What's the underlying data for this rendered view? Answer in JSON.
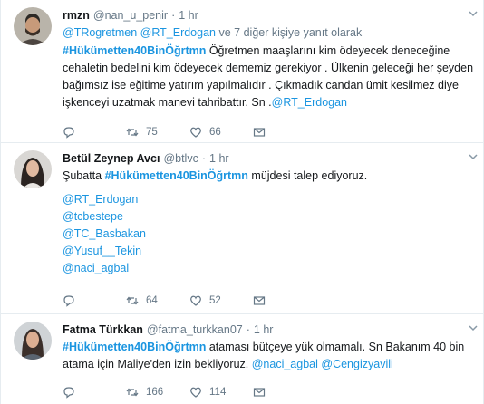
{
  "tweets": [
    {
      "name": "rmzn",
      "handle": "@nan_u_penir",
      "dot": "·",
      "time": "1 hr",
      "replying": {
        "mention1": "@TRogretmen",
        "mention2": "@RT_Erdogan",
        "suffix": "ve 7 diğer kişiye yanıt olarak"
      },
      "line1_hashtag": "#Hükümetten40BinÖğrtmn",
      "line1_text": " Öğretmen maaşlarını kim ödeyecek deneceğine",
      "line2": "cehaletin bedelini kim ödeyecek dememiz gerekiyor . Ülkenin geleceği her şeyden",
      "line3": "bağımsız ise eğitime yatırım yapılmalıdır . Çıkmadık candan ümit kesilmez diye",
      "line4_text": "işkenceyi uzatmak manevi tahribattır. Sn .",
      "line4_mention": "@RT_Erdogan",
      "retweets": "75",
      "likes": "66"
    },
    {
      "name": "Betül Zeynep Avcı",
      "handle": "@btlvc",
      "dot": "·",
      "time": "1 hr",
      "line1_pre": "Şubatta ",
      "line1_hashtag": "#Hükümetten40BinÖğrtmn",
      "line1_post": " müjdesi talep ediyoruz.",
      "mentions": [
        "@RT_Erdogan",
        "@tcbestepe",
        "@TC_Basbakan",
        "@Yusuf__Tekin",
        "@naci_agbal"
      ],
      "retweets": "64",
      "likes": "52"
    },
    {
      "name": "Fatma Türkkan",
      "handle": "@fatma_turkkan07",
      "dot": "·",
      "time": "1 hr",
      "line1_hashtag": "#Hükümetten40BinÖğrtmn",
      "line1_text": " ataması bütçeye yük olmamalı. Sn Bakanım 40 bin",
      "line2_text": "atama için Maliye'den izin bekliyoruz. ",
      "line2_mention1": "@naci_agbal",
      "line2_mention2": "@Cengizyavili",
      "retweets": "166",
      "likes": "114"
    }
  ],
  "colors": {
    "link": "#1b95e0",
    "secondary": "#657786",
    "border": "#e6ecf0"
  },
  "icons": [
    "chevron-down-icon",
    "reply-icon",
    "retweet-icon",
    "like-icon",
    "dm-icon"
  ]
}
